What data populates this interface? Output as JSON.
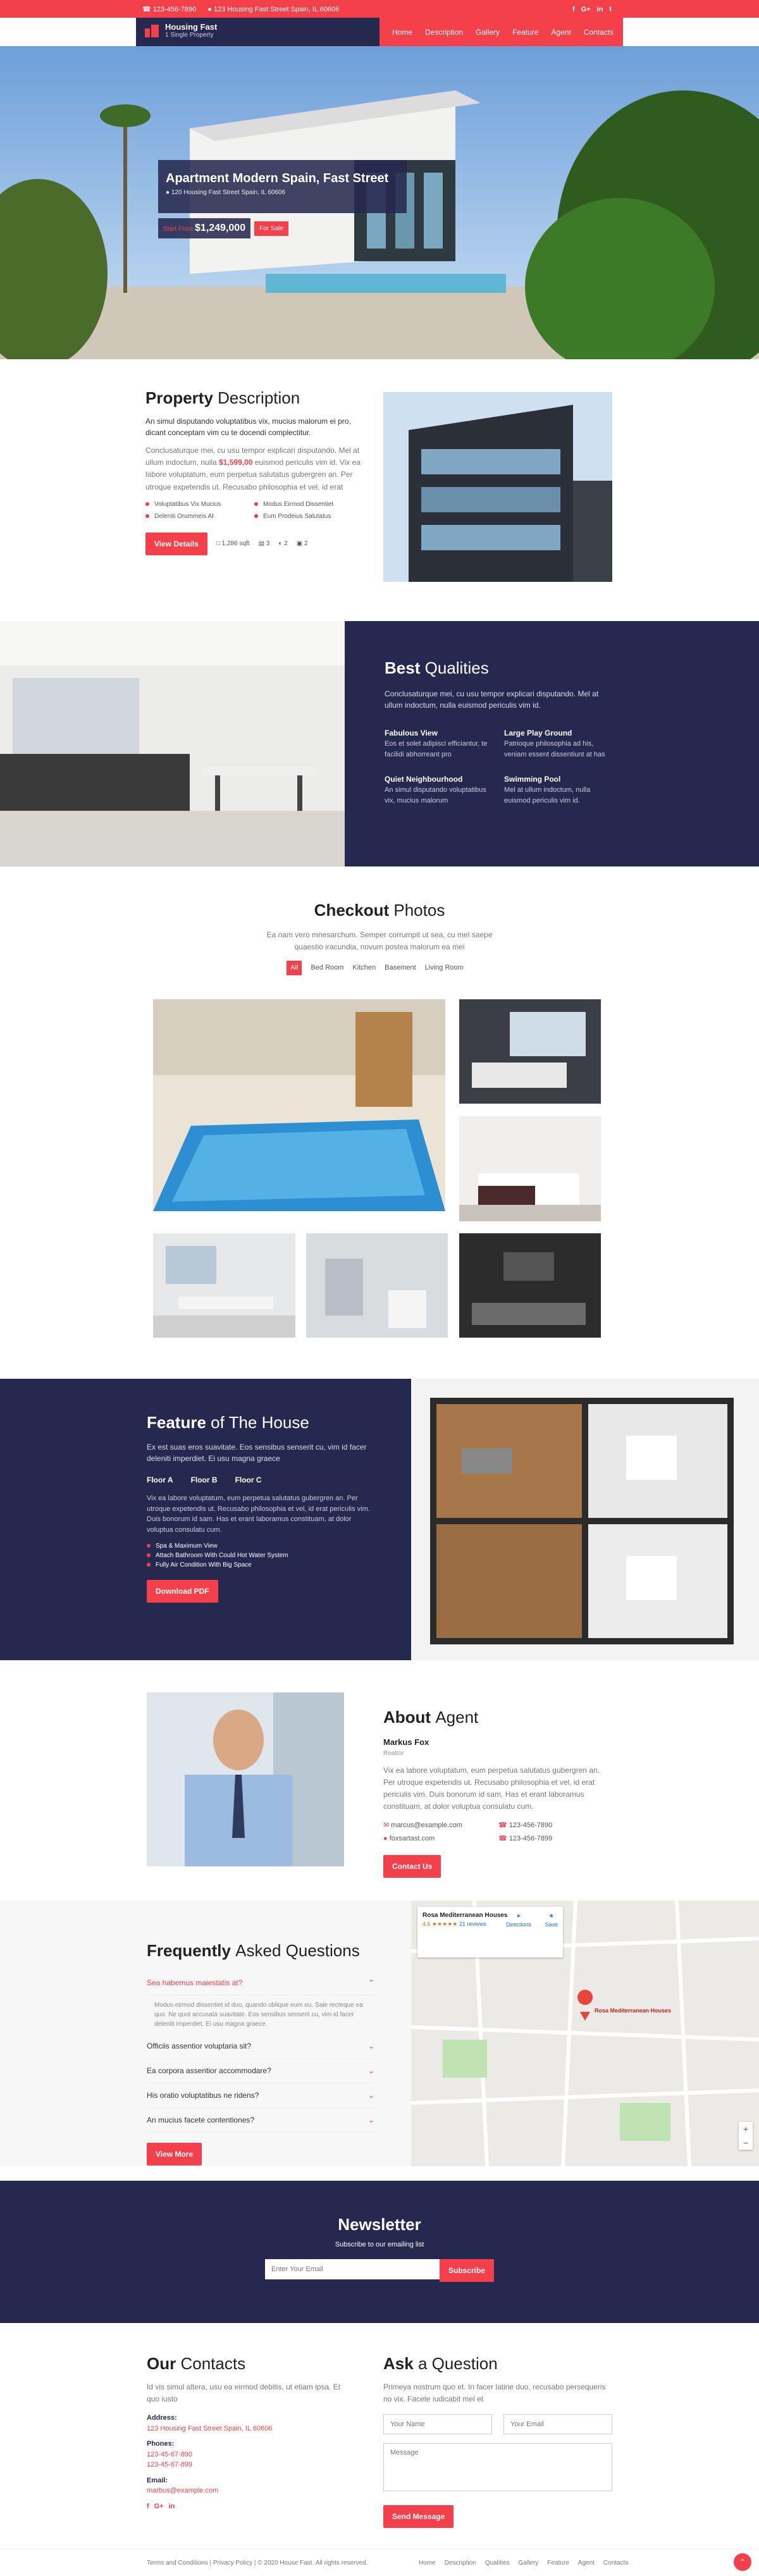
{
  "topbar": {
    "phone": "123-456-7890",
    "address": "123 Housing Fast Street Spain, IL 60606",
    "social": [
      "f",
      "G+",
      "in",
      "t"
    ]
  },
  "brand": {
    "name": "Housing Fast",
    "tagline": "1 Single Property"
  },
  "nav": [
    "Home",
    "Description",
    "Gallery",
    "Feature",
    "Agent",
    "Contacts"
  ],
  "hero": {
    "title": "Apartment Modern Spain, Fast Street",
    "address": "120 Housing Fast Street Spain, IL 60606",
    "price_prefix": "Start From",
    "price": "$1,249,000",
    "badge": "For Sale"
  },
  "description": {
    "title_bold": "Property",
    "title_thin": "Description",
    "lead": "An simul disputando voluptatibus vix, mucius malorum ei pro, dicant conceptam vim cu te docendi complectitur.",
    "text": "Conclusaturque mei, cu usu tempor explicari disputando. Mel at ullum indoctum, nulla",
    "price": "$1,599,00",
    "text2": "euismod periculis vim id. Vix ea labore voluptatum, eum perpetua salutatus gubergren an. Per utroque expetendis ut. Recusabo philosophia et vel, id erat",
    "features": [
      "Voluptatibus Vix Mucius",
      "Modus Eirmod Dissentiet",
      "Deleniti Orummeis At",
      "Eum Prodeius Salutatus"
    ],
    "button": "View Details",
    "stats": [
      "1,286 sqft",
      "3",
      "2",
      "2"
    ]
  },
  "qualities": {
    "title_bold": "Best",
    "title_thin": "Qualities",
    "lead": "Conclusaturque mei, cu usu tempor explicari disputando. Mel at ullum indoctum, nulla euismod periculis vim id.",
    "items": [
      {
        "title": "Fabulous View",
        "text": "Eos et solet adipisci efficiantur, te facilidi abhorreant pro"
      },
      {
        "title": "Large Play Ground",
        "text": "Patrioque philosophia ad his, veniam essent dissentiunt at has"
      },
      {
        "title": "Quiet Neighbourhood",
        "text": "An simul disputando voluptatibus vix, mucius malorum"
      },
      {
        "title": "Swimming Pool",
        "text": "Mel at ullum indoctum, nulla euismod periculis vim id."
      }
    ]
  },
  "photos": {
    "title_bold": "Checkout",
    "title_thin": "Photos",
    "lead": "Ea nam vero mnesarchum. Semper corrumpit ut sea, cu mel saepe quaestio iracundia, novum postea malorum ea mei",
    "filters": [
      "All",
      "Bed Room",
      "Kitchen",
      "Basement",
      "Living Room"
    ]
  },
  "feature": {
    "title_bold": "Feature",
    "title_thin": "of The House",
    "lead": "Ex est suas eros suavitate. Eos sensibus senserit cu, vim id facer deleniti imperdiet. Ei usu magna graece",
    "floors": [
      "Floor A",
      "Floor B",
      "Floor C"
    ],
    "text": "Vix ea labore voluptatum, eum perpetua salutatus gubergren an. Per utroque expetendis ut. Recusabo philosophia et vel, id erat periculis vim. Duis bonorum id sam. Has et erant laboramus constituam, at dolor voluptua consulatu cum.",
    "list": [
      "Spa & Maximum View",
      "Attach Bathroom With Could Hot Water System",
      "Fully Air Condition With Big Space"
    ],
    "button": "Download PDF"
  },
  "agent": {
    "title_bold": "About",
    "title_thin": "Agent",
    "name": "Markus Fox",
    "role": "Realtor",
    "text": "Vix ea labore voluptatum, eum perpetua salutatus gubergren an. Per utroque expetendis ut. Recusabo philosophia et vel, id erat periculis vim. Duis bonorum id sam. Has et erant laboramus constituam, at dolor voluptua consulatu cum.",
    "email": "marcus@example.com",
    "phone": "123-456-7890",
    "site": "foxsartast.com",
    "phone2": "123-456-7899",
    "button": "Contact Us"
  },
  "faq": {
    "title_bold": "Frequently",
    "title_thin": "Asked Questions",
    "open_question": "Sea habemus maiestatis at?",
    "open_answer": "Modus eirmod dissentiet id duo, quando oblique eum eu. Sale recteque ea quo. Ne quot accusata suavitate. Eos sensibus senserit cu, vim id facer deleniti imperdiet. Ei usu magna graece.",
    "questions": [
      "Officiis assentior voluptaria sit?",
      "Ea corpora assentior accommodare?",
      "His oratio voluptatibus ne ridens?",
      "An mucius facete contentiones?"
    ],
    "button": "View More"
  },
  "map": {
    "place": "Rosa Mediterranean Houses",
    "rating": "4.6",
    "reviews": "21 reviews",
    "directions": "Directions",
    "save": "Save",
    "pin_label": "Rosa Mediterranean Houses"
  },
  "newsletter": {
    "title": "Newsletter",
    "subtitle": "Subscribe to our emailing list",
    "placeholder": "Enter Your Email",
    "button": "Subscribe"
  },
  "contacts": {
    "title_bold": "Our",
    "title_thin": "Contacts",
    "lead": "Id vis simul altera, usu ea eirmod debitis, ut etiam ipsa. Et quo iusto",
    "address_label": "Address:",
    "address": "123 Housing Fast Street Spain, IL 60606",
    "phones_label": "Phones:",
    "phones": [
      "123-45-67-890",
      "123-45-67-899"
    ],
    "email_label": "Email:",
    "email": "marbus@example.com"
  },
  "ask": {
    "title_bold": "Ask",
    "title_thin": "a Question",
    "lead": "Primeya nostrum quo et. In facer latine duo, recusabo persequeris no vix. Facete iudicabit mel et",
    "name_ph": "Your Name",
    "email_ph": "Your Email",
    "message_ph": "Message",
    "button": "Send Message"
  },
  "footer": {
    "left": "Terms and Conditions | Privacy Policy | © 2020 House Fast. All rights reserved.",
    "links": [
      "Home",
      "Description",
      "Qualities",
      "Gallery",
      "Feature",
      "Agent",
      "Contacts"
    ]
  },
  "colors": {
    "accent": "#f4404a",
    "navy": "#26294f"
  }
}
